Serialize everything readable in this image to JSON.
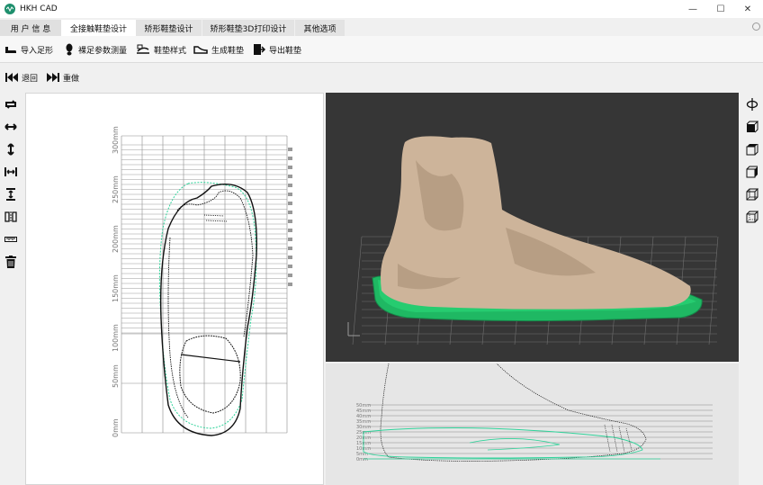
{
  "window": {
    "title": "HKH CAD",
    "controls": [
      "—",
      "☐",
      "✕"
    ]
  },
  "tabs": [
    {
      "label": "用 户 信 息"
    },
    {
      "label": "全接触鞋垫设计"
    },
    {
      "label": "矫形鞋垫设计"
    },
    {
      "label": "矫形鞋垫3D打印设计"
    },
    {
      "label": "其他选项"
    }
  ],
  "active_tab": 1,
  "toolbar": {
    "import_foot": "导入足形",
    "barefoot_measure": "裸足参数测量",
    "insole_style": "鞋垫样式",
    "generate_insole": "生成鞋垫",
    "export_insole": "导出鞋垫",
    "undo": "退回",
    "redo": "重做"
  },
  "left_tools": [
    "rotate-icon",
    "horizontal-resize-icon",
    "vertical-resize-icon",
    "horizontal-fit-icon",
    "vertical-fit-icon",
    "mirror-icon",
    "ruler-icon",
    "trash-icon"
  ],
  "right_tools": [
    "axis-rotate-icon",
    "view-cube-front-icon",
    "view-cube-top-icon",
    "view-cube-side-icon",
    "view-cube-iso-icon",
    "view-cube-wire-icon"
  ],
  "plan_view": {
    "scale_labels": [
      "0mm",
      "50mm",
      "100mm",
      "150mm",
      "200mm",
      "250mm",
      "300mm"
    ],
    "grid_color": "#8a8a8a",
    "outline_color": "#111111",
    "insole_color": "#2fd39a"
  },
  "view_3d": {
    "background": "#363636",
    "foot_color": "#cdb49a",
    "insole_color": "#1fb863"
  },
  "side_view": {
    "scale_labels": [
      "0mm",
      "5mm",
      "10mm",
      "15mm",
      "20mm",
      "25mm",
      "30mm",
      "35mm",
      "40mm",
      "45mm",
      "50mm"
    ],
    "insole_color": "#2fd39a"
  }
}
